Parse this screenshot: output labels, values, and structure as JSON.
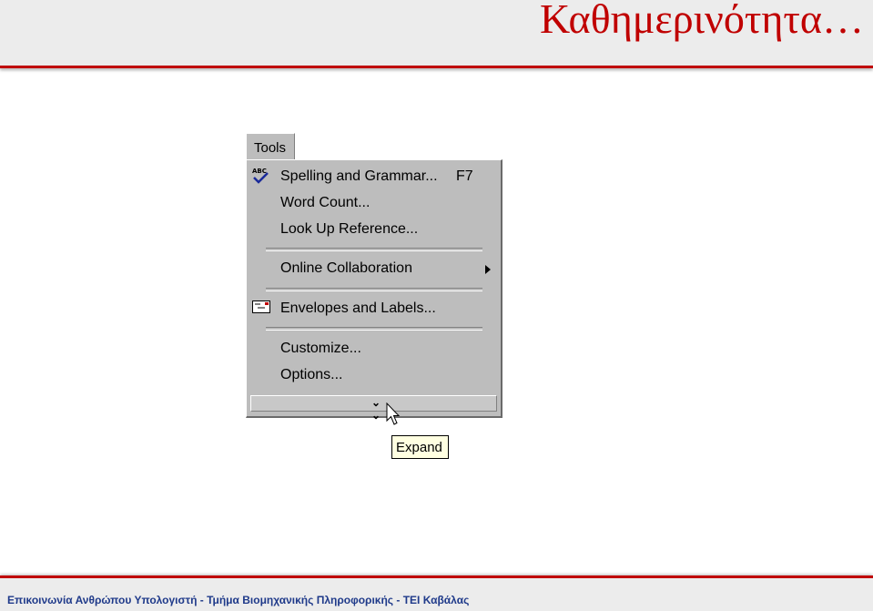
{
  "slide": {
    "title": "Καθημερινότητα…",
    "footer": "Επικοινωνία Ανθρώπου Υπολογιστή - Τμήμα Βιομηχανικής Πληροφορικής - ΤΕΙ Καβάλας"
  },
  "menu": {
    "header": "Tools",
    "items": [
      {
        "label": "Spelling and Grammar...",
        "shortcut": "F7",
        "icon": "spelling-check-icon"
      },
      {
        "label": "Word Count..."
      },
      {
        "label": "Look Up Reference..."
      },
      {
        "label": "Online Collaboration",
        "submenu": true
      },
      {
        "label": "Envelopes and Labels...",
        "icon": "envelope-icon"
      },
      {
        "label": "Customize..."
      },
      {
        "label": "Options..."
      }
    ],
    "expand_icon": "double-chevron-down-icon"
  },
  "tooltip": {
    "text": "Expand"
  },
  "colors": {
    "accent": "#c00000",
    "menu_bg": "#bdbdbd",
    "tooltip_bg": "#ffffe1",
    "footer_text": "#1f3a8a"
  }
}
